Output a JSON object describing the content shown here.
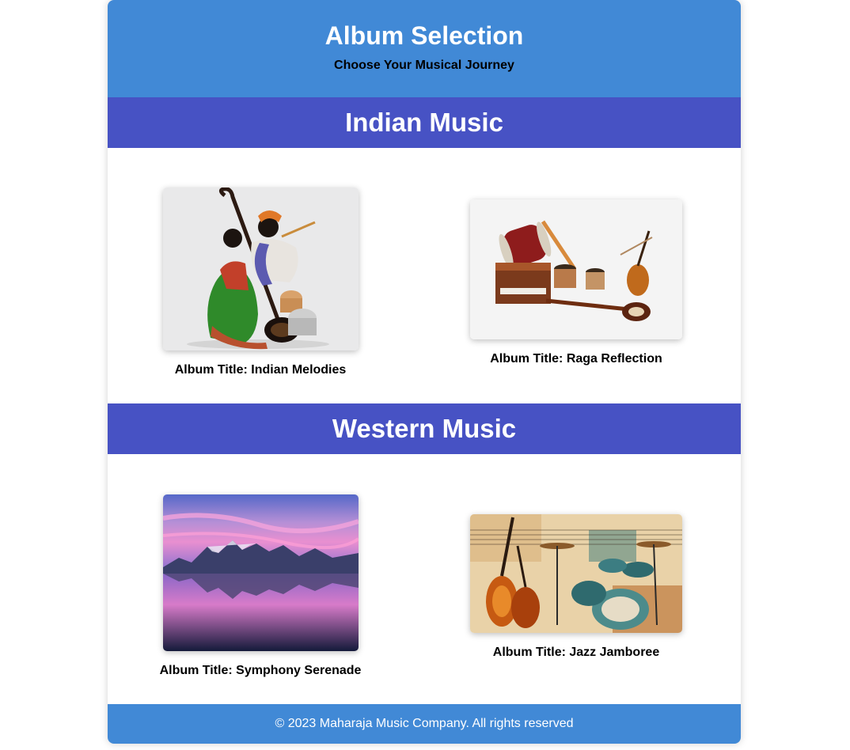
{
  "header": {
    "title": "Album Selection",
    "subtitle": "Choose Your Musical Journey"
  },
  "sections": [
    {
      "title": "Indian Music",
      "albums": [
        {
          "label": "Album Title: Indian Melodies",
          "image": "indian-musicians-sculpture"
        },
        {
          "label": "Album Title: Raga Reflection",
          "image": "indian-instruments"
        }
      ]
    },
    {
      "title": "Western Music",
      "albums": [
        {
          "label": "Album Title: Symphony Serenade",
          "image": "mountain-lake-sunset"
        },
        {
          "label": "Album Title: Jazz Jamboree",
          "image": "violin-drum-kit-collage"
        }
      ]
    }
  ],
  "footer": {
    "text": "© 2023 Maharaja Music Company. All rights reserved"
  },
  "colors": {
    "header_bg": "#4189d6",
    "section_bg": "#4752c4",
    "footer_bg": "#4189d6"
  }
}
